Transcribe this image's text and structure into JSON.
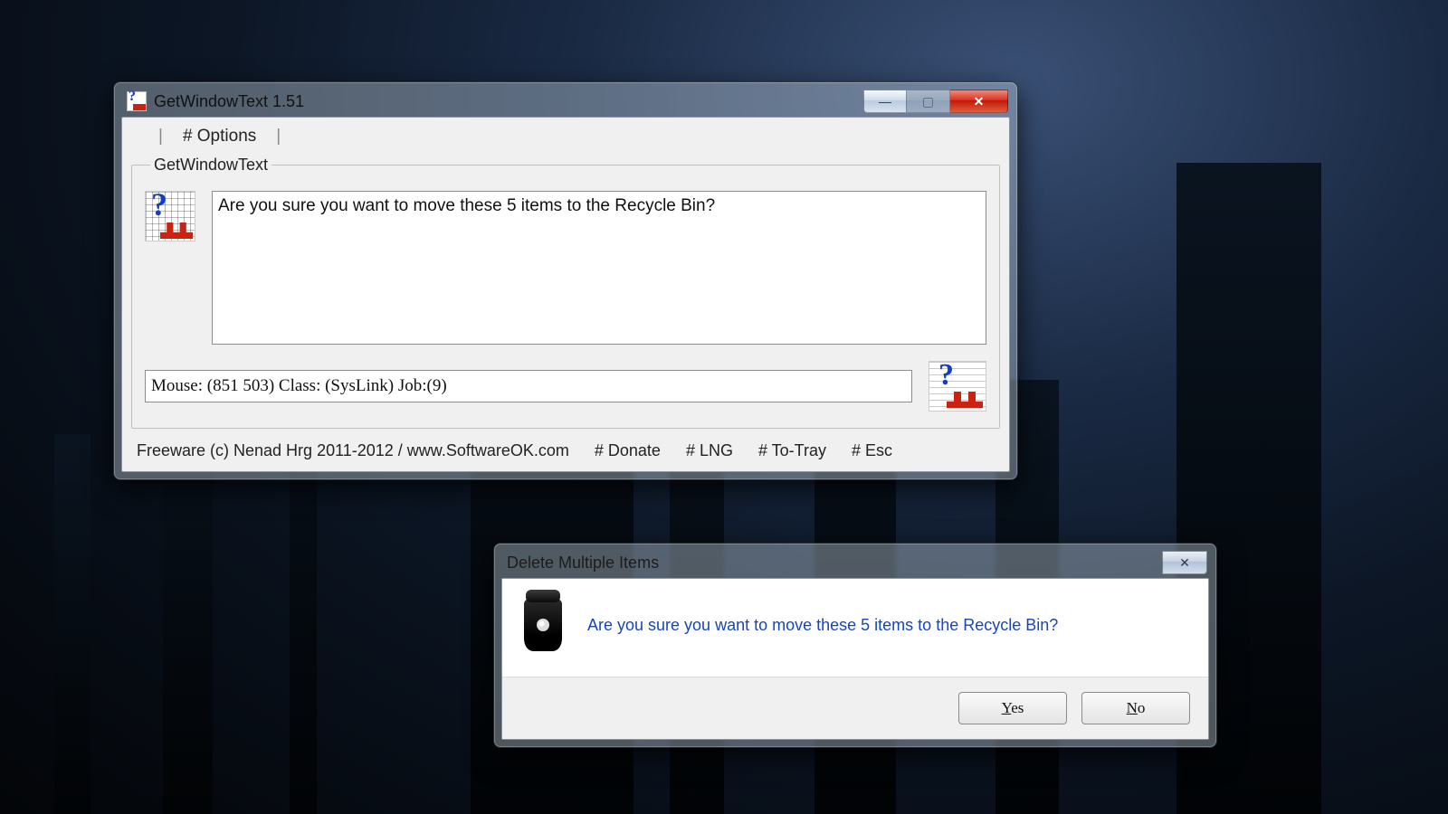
{
  "main_window": {
    "title": "GetWindowText 1.51",
    "menu": {
      "options": "# Options"
    },
    "group_legend": "GetWindowText",
    "captured_text": "Are you sure you want to move these 5 items to the Recycle Bin?",
    "status": "Mouse: (851 503) Class: (SysLink) Job:(9)",
    "footer": {
      "credit": "Freeware (c) Nenad Hrg 2011-2012 / www.SoftwareOK.com",
      "donate": "# Donate",
      "lng": "# LNG",
      "to_tray": "# To-Tray",
      "esc": "# Esc"
    },
    "caption": {
      "minimize": "—",
      "maximize": "▢",
      "close": "✕"
    }
  },
  "dialog": {
    "title": "Delete Multiple Items",
    "message": "Are you sure you want to move these 5 items to the Recycle Bin?",
    "buttons": {
      "yes": "Yes",
      "no": "No"
    },
    "caption": {
      "close": "✕"
    }
  },
  "icons": {
    "app": "getwindowtext-icon",
    "target": "crosshair-grabber-icon",
    "trash": "recycle-bin-icon"
  }
}
